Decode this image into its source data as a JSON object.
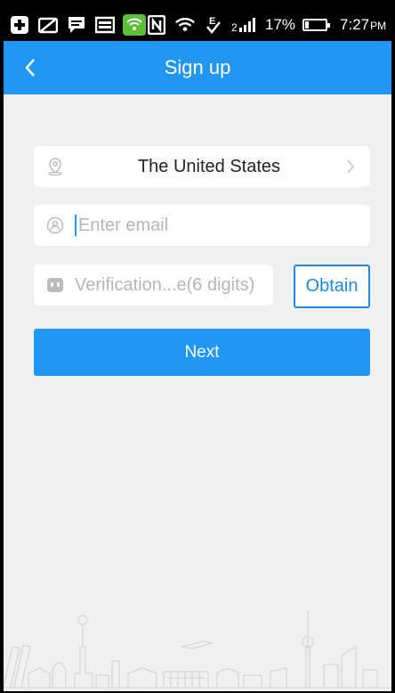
{
  "status_bar": {
    "battery_percent": "17%",
    "battery_level": 0.17,
    "time": "7:27",
    "ampm": "PM",
    "icons": [
      "plus-square-icon",
      "slash-card-icon",
      "message-icon",
      "image-icon",
      "green-wireless-icon",
      "nfc-icon",
      "wifi-icon",
      "e-signal-icon",
      "cell-signal-icon"
    ]
  },
  "header": {
    "title": "Sign up",
    "color": "#2196f3"
  },
  "form": {
    "country": "The United States",
    "email_placeholder": "Enter email",
    "code_placeholder": "Verification...e(6 digits)",
    "obtain_label": "Obtain",
    "next_label": "Next"
  },
  "colors": {
    "accent": "#2196f3",
    "background": "#f0f0f0"
  }
}
